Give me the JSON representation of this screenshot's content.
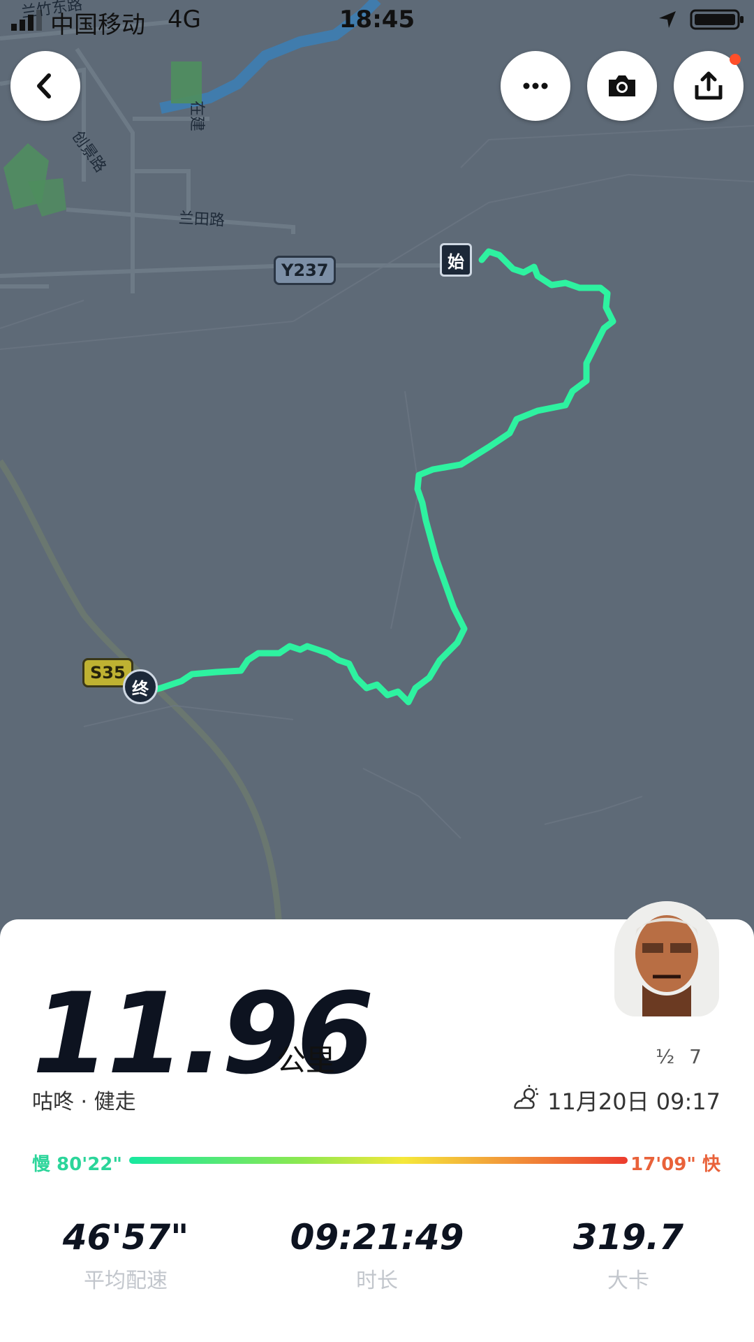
{
  "status_bar": {
    "carrier": "中国移动",
    "network": "4G",
    "time": "18:45"
  },
  "map": {
    "road_labels": [
      "兰竹东路",
      "创景路",
      "在建",
      "兰田路"
    ],
    "route_badges": [
      "Y237",
      "S35"
    ],
    "start_marker": "始",
    "end_marker": "终",
    "route_color": "#2ef2a0"
  },
  "toolbar": {
    "back_icon": "back-arrow-icon",
    "more_icon": "more-dots-icon",
    "camera_icon": "camera-icon",
    "share_icon": "share-icon"
  },
  "summary": {
    "distance": "11.96",
    "distance_unit": "公里",
    "activity": "咕咚 · 健走",
    "date": "11月20日 09:17",
    "weather_icon": "partly-cloudy-icon",
    "user_name": "½ 7"
  },
  "pace_scale": {
    "slow": "慢 80'22\"",
    "fast": "17'09\" 快",
    "colors": [
      "#17e8a0",
      "#f5e83a",
      "#ec3b2e"
    ]
  },
  "stats": [
    {
      "value": "46'57\"",
      "label": "平均配速"
    },
    {
      "value": "09:21:49",
      "label": "时长"
    },
    {
      "value": "319.7",
      "label": "大卡"
    }
  ]
}
